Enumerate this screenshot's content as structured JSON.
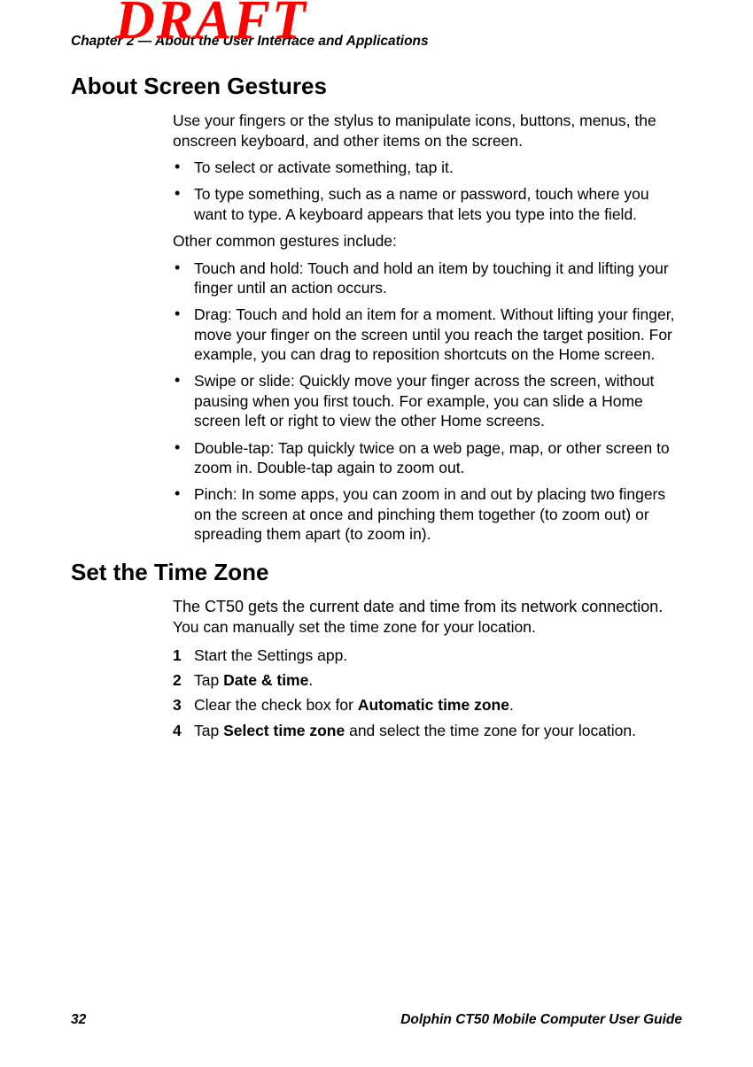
{
  "watermark": "DRAFT",
  "runningHeader": "Chapter 2 — About the User Interface and Applications",
  "section1": {
    "title": "About Screen Gestures",
    "intro": "Use your fingers or the stylus to manipulate icons, buttons, menus, the onscreen keyboard, and other items on the screen.",
    "introBullets": [
      "To select or activate something, tap it.",
      "To type something, such as a name or password, touch where you want to type. A keyboard appears that lets you type into the field."
    ],
    "commonLead": "Other common gestures include:",
    "gestures": [
      {
        "name": "Touch and hold:",
        "desc": "Touch and hold an item by touching it and lifting your finger until an action occurs."
      },
      {
        "name": "Drag:",
        "desc": "Touch and hold an item for a moment. Without lifting your finger, move your finger on the screen until you reach the target position. For example, you can drag to reposition shortcuts on the Home screen."
      },
      {
        "name": "Swipe or slide:",
        "desc": "Quickly move your finger across the screen, without pausing when you first touch. For example, you can slide a Home screen left or right to view the other Home screens."
      },
      {
        "name": "Double-tap:",
        "desc": "Tap quickly twice on a web page, map, or other screen to zoom in. Double-tap again to zoom out."
      },
      {
        "name": "Pinch:",
        "desc": "In some apps, you can zoom in and out by placing two fingers on the screen at once and pinching them together (to zoom out) or spreading them apart (to zoom in)."
      }
    ]
  },
  "section2": {
    "title": "Set the Time Zone",
    "intro1": "The CT50 gets the current date and time from its network connection.",
    "intro2": "You can manually set the time zone for your location.",
    "steps": [
      {
        "num": "1",
        "text_before": "Start the Settings app.",
        "bold": "",
        "text_after": ""
      },
      {
        "num": "2",
        "text_before": "Tap ",
        "bold": "Date & time",
        "text_after": "."
      },
      {
        "num": "3",
        "text_before": "Clear the check box for ",
        "bold": "Automatic time zone",
        "text_after": "."
      },
      {
        "num": "4",
        "text_before": "Tap ",
        "bold": "Select time zone",
        "text_after": " and select the time zone for your location."
      }
    ]
  },
  "footer": {
    "pageNum": "32",
    "guide": "Dolphin CT50 Mobile Computer User Guide"
  }
}
